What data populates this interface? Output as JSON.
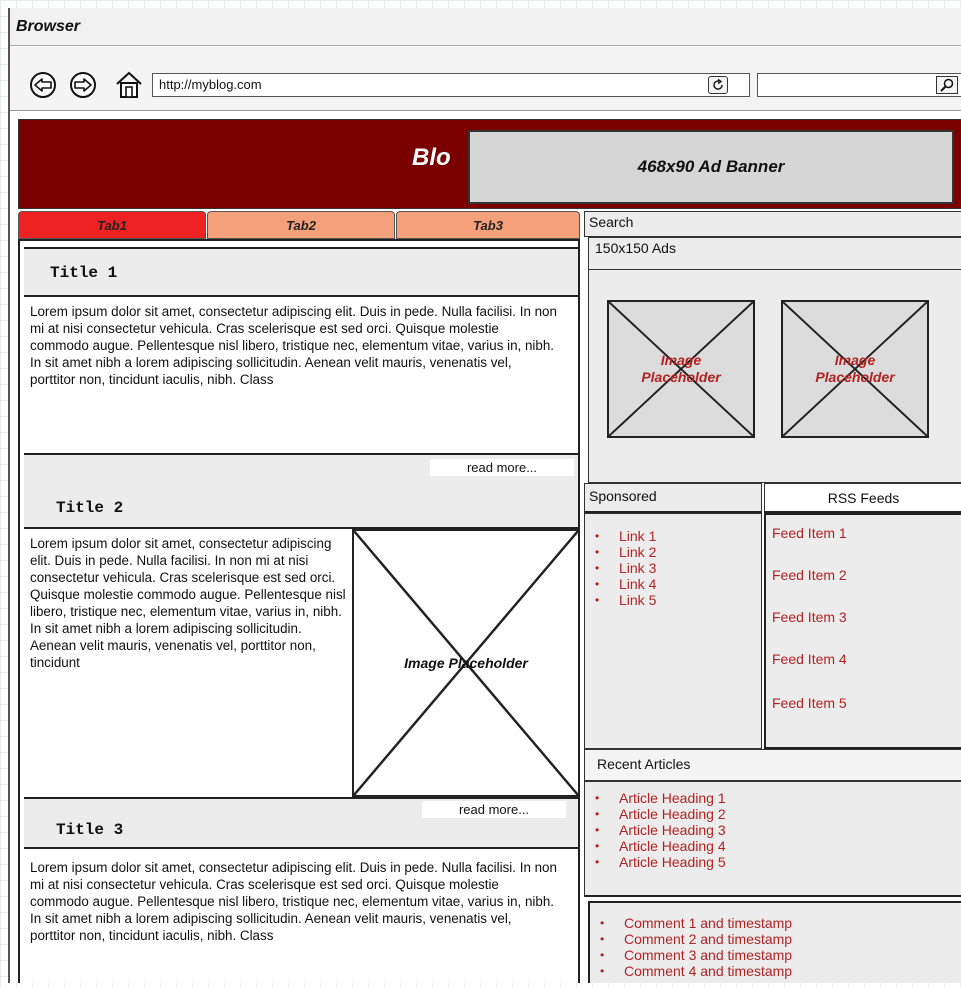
{
  "browser": {
    "title": "Browser",
    "url": "http://myblog.com",
    "search_value": ""
  },
  "header": {
    "blog_title": "Blo",
    "ad_banner": "468x90 Ad Banner"
  },
  "tabs": [
    "Tab1",
    "Tab2",
    "Tab3"
  ],
  "posts": [
    {
      "title": "Title 1",
      "body": "Lorem ipsum dolor sit amet, consectetur adipiscing elit. Duis in pede. Nulla facilisi. In non mi at nisi consectetur vehicula. Cras scelerisque est sed orci. Quisque molestie commodo augue. Pellentesque nisl libero, tristique nec, elementum vitae, varius in, nibh. In sit amet nibh a lorem adipiscing sollicitudin. Aenean velit mauris, venenatis vel, porttitor non, tincidunt iaculis, nibh. Class",
      "read_more": "read more..."
    },
    {
      "title": "Title 2",
      "body": "Lorem ipsum dolor sit amet, consectetur adipiscing elit. Duis in pede. Nulla facilisi. In non mi at nisi consectetur vehicula. Cras scelerisque est sed orci. Quisque molestie commodo augue. Pellentesque nisl libero, tristique nec, elementum vitae, varius in, nibh. In sit amet nibh a lorem adipiscing sollicitudin. Aenean velit mauris, venenatis vel, porttitor non, tincidunt",
      "image_label": "Image Placeholder",
      "read_more": "read more..."
    },
    {
      "title": "Title 3",
      "body": "Lorem ipsum dolor sit amet, consectetur adipiscing elit. Duis in pede. Nulla facilisi. In non mi at nisi consectetur vehicula. Cras scelerisque est sed orci. Quisque molestie commodo augue. Pellentesque nisl libero, tristique nec, elementum vitae, varius in, nibh. In sit amet nibh a lorem adipiscing sollicitudin. Aenean velit mauris, venenatis vel, porttitor non, tincidunt iaculis, nibh. Class"
    }
  ],
  "sidebar": {
    "search_label": "Search",
    "ads_title": "150x150 Ads",
    "ad_placeholders": [
      {
        "line1": "Image",
        "line2": "Placeholder"
      },
      {
        "line1": "Image",
        "line2": "Placeholder"
      }
    ],
    "sponsored_title": "Sponsored",
    "sponsored_links": [
      "Link 1",
      "Link 2",
      "Link 3",
      "Link 4",
      "Link 5"
    ],
    "rss_title": "RSS Feeds",
    "feed_items": [
      "Feed Item 1",
      "Feed Item 2",
      "Feed Item 3",
      "Feed Item 4",
      "Feed Item 5"
    ],
    "recent_title": "Recent Articles",
    "recent_articles": [
      "Article Heading 1",
      "Article Heading 2",
      "Article Heading 3",
      "Article Heading 4",
      "Article Heading 5"
    ],
    "comments": [
      "Comment 1 and timestamp",
      "Comment 2 and timestamp",
      "Comment 3 and timestamp",
      "Comment 4 and timestamp"
    ]
  },
  "colors": {
    "header_bg": "#7a0000",
    "tab_active": "#ee2222",
    "tab_inactive": "#f4a07a",
    "link_red": "#b22222",
    "panel_gray": "#ececec"
  },
  "icons": [
    "back-icon",
    "forward-icon",
    "home-icon",
    "refresh-icon",
    "magnifier-icon"
  ]
}
